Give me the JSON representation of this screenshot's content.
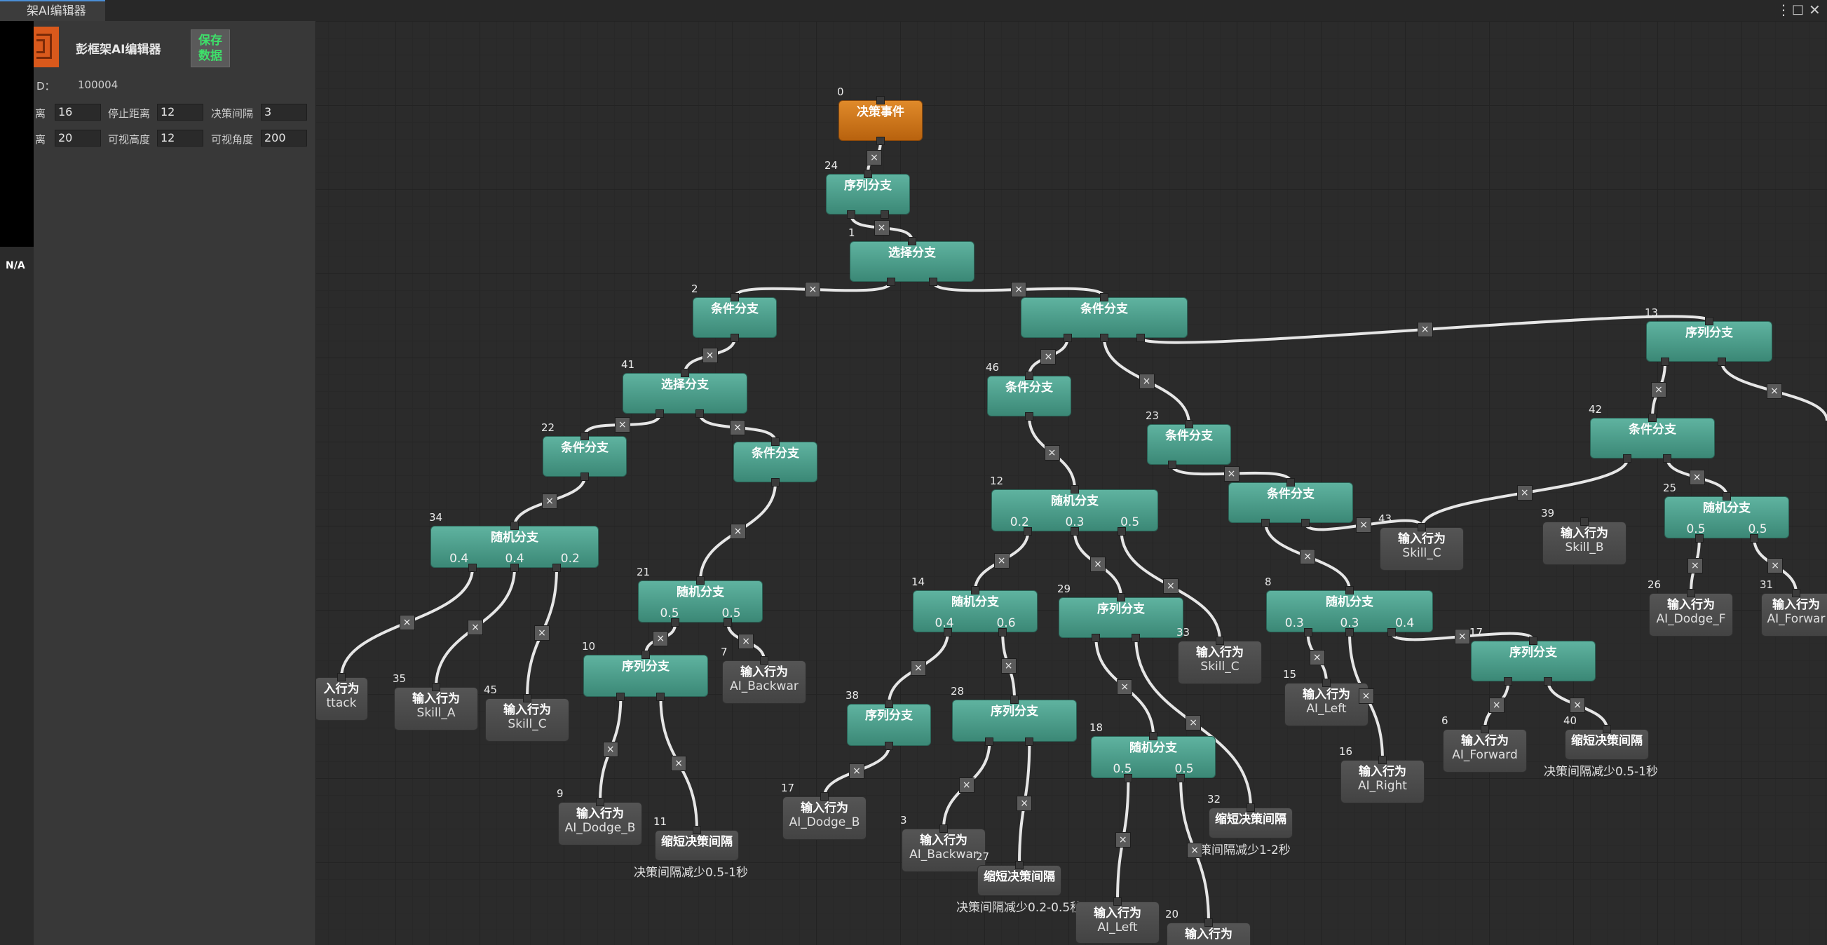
{
  "window": {
    "tab_title": "架AI编辑器",
    "menu_glyph": "⋮",
    "maximize_glyph": "□",
    "close_glyph": "✕"
  },
  "status": {
    "na": "N/A"
  },
  "panel": {
    "title": "彭框架AI编辑器",
    "save_label_1": "保存",
    "save_label_2": "数据",
    "id_label": "D：",
    "id_value": "100004",
    "row1": [
      {
        "label": "离",
        "value": "16"
      },
      {
        "label": "停止距离",
        "value": "12"
      },
      {
        "label": "决策间隔",
        "value": "3"
      }
    ],
    "row2": [
      {
        "label": "离",
        "value": "20"
      },
      {
        "label": "可视高度",
        "value": "12"
      },
      {
        "label": "可视角度",
        "value": "200"
      }
    ]
  },
  "graph": {
    "nodes": [
      {
        "id": "0",
        "title": "决策事件",
        "kind": "orange"
      },
      {
        "id": "24",
        "title": "序列分支",
        "kind": "teal"
      },
      {
        "id": "1",
        "title": "选择分支",
        "kind": "teal"
      },
      {
        "id": "2",
        "title": "条件分支",
        "kind": "teal"
      },
      {
        "id": "",
        "title": "条件分支",
        "kind": "teal"
      },
      {
        "id": "13",
        "title": "序列分支",
        "kind": "teal"
      },
      {
        "id": "41",
        "title": "选择分支",
        "kind": "teal"
      },
      {
        "id": "46",
        "title": "条件分支",
        "kind": "teal"
      },
      {
        "id": "23",
        "title": "条件分支",
        "kind": "teal"
      },
      {
        "id": "42",
        "title": "条件分支",
        "kind": "teal"
      },
      {
        "id": "22",
        "title": "条件分支",
        "kind": "teal"
      },
      {
        "id": "",
        "title": "条件分支",
        "kind": "teal"
      },
      {
        "id": "12",
        "title": "随机分支",
        "kind": "teal",
        "probs": [
          "0.2",
          "0.3",
          "0.5"
        ]
      },
      {
        "id": "",
        "title": "条件分支",
        "kind": "teal"
      },
      {
        "id": "25",
        "title": "随机分支",
        "kind": "teal",
        "probs": [
          "0.5",
          "0.5"
        ]
      },
      {
        "id": "34",
        "title": "随机分支",
        "kind": "teal",
        "probs": [
          "0.4",
          "0.4",
          "0.2"
        ]
      },
      {
        "id": "43",
        "title": "输入行为",
        "kind": "gray",
        "sub": "Skill_C"
      },
      {
        "id": "39",
        "title": "输入行为",
        "kind": "gray",
        "sub": "Skill_B"
      },
      {
        "id": "21",
        "title": "随机分支",
        "kind": "teal",
        "probs": [
          "0.5",
          "0.5"
        ]
      },
      {
        "id": "14",
        "title": "随机分支",
        "kind": "teal",
        "probs": [
          "0.4",
          "0.6"
        ]
      },
      {
        "id": "29",
        "title": "序列分支",
        "kind": "teal"
      },
      {
        "id": "8",
        "title": "随机分支",
        "kind": "teal",
        "probs": [
          "0.3",
          "0.3",
          "0.4"
        ]
      },
      {
        "id": "26",
        "title": "输入行为",
        "kind": "gray",
        "sub": "AI_Dodge_F"
      },
      {
        "id": "31",
        "title": "输入行为",
        "kind": "gray",
        "sub": "AI_Forwar"
      },
      {
        "id": "10",
        "title": "序列分支",
        "kind": "teal"
      },
      {
        "id": "7",
        "title": "输入行为",
        "kind": "gray",
        "sub": "AI_Backwar"
      },
      {
        "id": "33",
        "title": "输入行为",
        "kind": "gray",
        "sub": "Skill_C"
      },
      {
        "id": "17",
        "title": "序列分支",
        "kind": "teal"
      },
      {
        "id": "",
        "title": "入行为",
        "kind": "gray",
        "sub": "ttack"
      },
      {
        "id": "35",
        "title": "输入行为",
        "kind": "gray",
        "sub": "Skill_A"
      },
      {
        "id": "45",
        "title": "输入行为",
        "kind": "gray",
        "sub": "Skill_C"
      },
      {
        "id": "38",
        "title": "序列分支",
        "kind": "teal"
      },
      {
        "id": "28",
        "title": "序列分支",
        "kind": "teal"
      },
      {
        "id": "15",
        "title": "输入行为",
        "kind": "gray",
        "sub": "AI_Left"
      },
      {
        "id": "6",
        "title": "输入行为",
        "kind": "gray",
        "sub": "AI_Forward"
      },
      {
        "id": "40",
        "title": "缩短决策间隔",
        "kind": "gray",
        "extra": "决策间隔减少0.5-1秒"
      },
      {
        "id": "18",
        "title": "随机分支",
        "kind": "teal",
        "probs": [
          "0.5",
          "0.5"
        ]
      },
      {
        "id": "16",
        "title": "输入行为",
        "kind": "gray",
        "sub": "AI_Right"
      },
      {
        "id": "17",
        "title": "输入行为",
        "kind": "gray",
        "sub": "AI_Dodge_B"
      },
      {
        "id": "9",
        "title": "输入行为",
        "kind": "gray",
        "sub": "AI_Dodge_B"
      },
      {
        "id": "11",
        "title": "缩短决策间隔",
        "kind": "gray",
        "extra": "决策间隔减少0.5-1秒"
      },
      {
        "id": "32",
        "title": "缩短决策间隔",
        "kind": "gray",
        "extra": "决策间隔减少1-2秒"
      },
      {
        "id": "3",
        "title": "输入行为",
        "kind": "gray",
        "sub": "AI_Backwar"
      },
      {
        "id": "27",
        "title": "缩短决策间隔",
        "kind": "gray",
        "extra": "决策间隔减少0.2-0.5秒"
      },
      {
        "id": "",
        "title": "输入行为",
        "kind": "gray",
        "sub": "AI_Left"
      },
      {
        "id": "20",
        "title": "输入行为",
        "kind": "gray",
        "sub": ""
      }
    ],
    "port_labels": [
      "0",
      "1",
      "2"
    ],
    "remove_glyph": "×"
  }
}
